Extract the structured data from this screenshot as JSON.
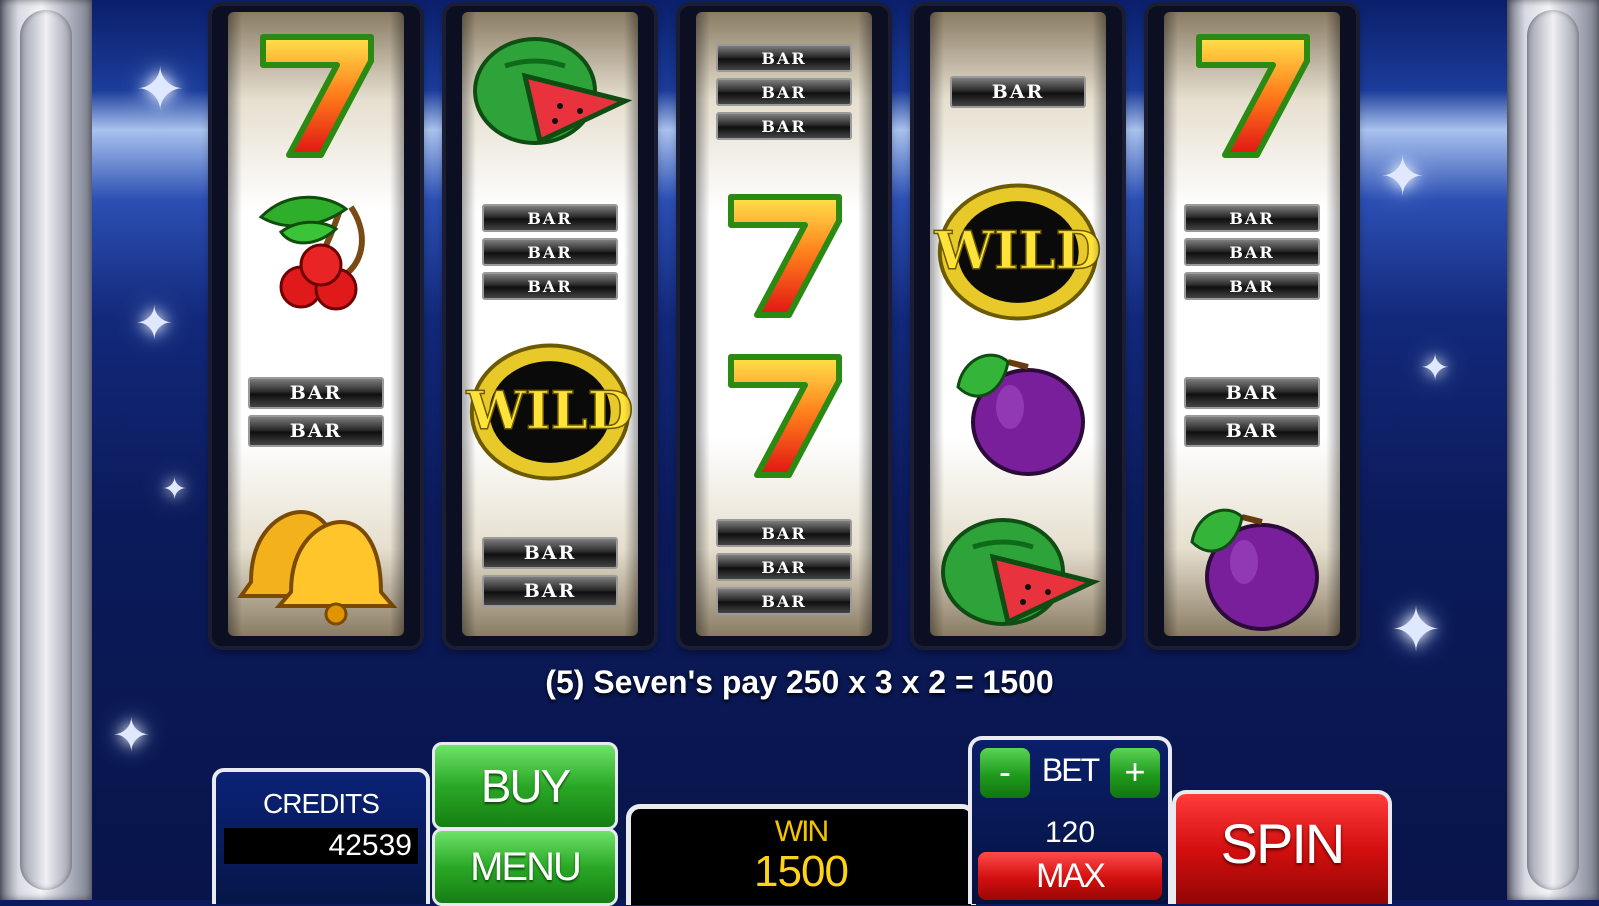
{
  "game": {
    "message": "(5) Seven's pay 250 x 3 x 2 = 1500",
    "bar_text": "BAR",
    "wild_text": "WILD",
    "seven_text": "7"
  },
  "reels": [
    {
      "symbols": [
        "seven",
        "cherry",
        "double-bar",
        "bell"
      ]
    },
    {
      "symbols": [
        "watermelon",
        "triple-bar",
        "wild",
        "double-bar"
      ]
    },
    {
      "symbols": [
        "triple-bar",
        "seven",
        "seven",
        "triple-bar"
      ]
    },
    {
      "symbols": [
        "single-bar",
        "wild",
        "plum",
        "watermelon"
      ]
    },
    {
      "symbols": [
        "seven",
        "triple-bar",
        "double-bar",
        "plum"
      ]
    }
  ],
  "controls": {
    "credits_label": "CREDITS",
    "credits_value": "42539",
    "buy_label": "BUY",
    "menu_label": "MENU",
    "win_label": "WIN",
    "win_value": "1500",
    "bet_minus": "-",
    "bet_label": "BET",
    "bet_plus": "+",
    "bet_value": "120",
    "max_label": "MAX",
    "spin_label": "SPIN"
  },
  "colors": {
    "background": "#0b1f6b",
    "buy_green": "#2aa826",
    "spin_red": "#d40f0f",
    "win_gold": "#ffd21a"
  }
}
